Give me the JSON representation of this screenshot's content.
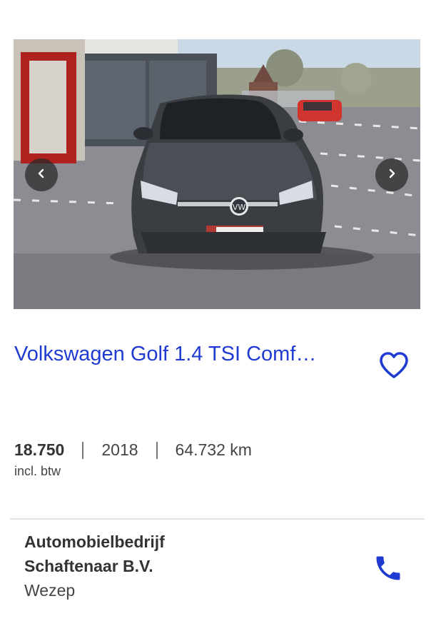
{
  "listing": {
    "title": "Volkswagen Golf 1.4 TSI Comf…",
    "price": "18.750",
    "price_note": "incl. btw",
    "year": "2018",
    "mileage": "64.732 km"
  },
  "dealer": {
    "name": "Automobielbedrijf Schaftenaar B.V.",
    "city": "Wezep"
  },
  "colors": {
    "title": "#1f3bd1",
    "accent": "#1f3bd1"
  },
  "icons": {
    "prev": "chevron-left-icon",
    "next": "chevron-right-icon",
    "favorite": "heart-outline-icon",
    "phone": "phone-icon"
  }
}
